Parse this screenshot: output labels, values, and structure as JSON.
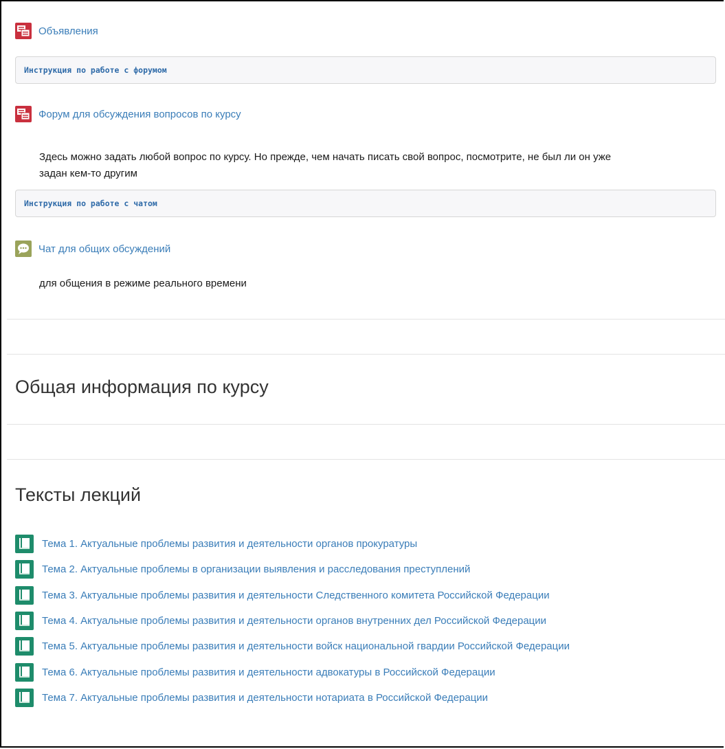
{
  "activities": {
    "announcements": "Объявления",
    "forum_instruction": "Инструкция по работе с форумом",
    "forum": "Форум для обсуждения вопросов по курсу",
    "forum_desc_line1": "Здесь можно задать любой вопрос по курсу. Но прежде, чем начать писать свой вопрос, посмотрите, не был ли он уже",
    "forum_desc_line2": "задан кем-то другим",
    "chat_instruction": "Инструкция по работе с чатом",
    "chat": "Чат для общих обсуждений",
    "chat_desc": "для общения в режиме реального времени"
  },
  "sections": {
    "general_info": "Общая информация по курсу",
    "lectures": "Тексты лекций"
  },
  "topics": [
    "Тема 1. Актуальные проблемы развития и деятельности органов прокуратуры",
    "Тема 2. Актуальные проблемы в организации выявления и расследования преступлений",
    "Тема 3. Актуальные проблемы развития и деятельности Следственного комитета Российской Федерации",
    "Тема 4. Актуальные проблемы развития и деятельности органов внутренних дел Российской Федерации",
    "Тема 5. Актуальные проблемы развития и деятельности войск национальной гвардии Российской Федерации",
    "Тема 6. Актуальные проблемы развития и деятельности адвокатуры в Российской Федерации",
    "Тема 7. Актуальные проблемы развития и деятельности нотариата в Российской Федерации"
  ],
  "icons": {
    "forum": "forum-icon",
    "chat": "chat-icon",
    "book": "book-icon"
  },
  "colors": {
    "link": "#3a7db8",
    "forum_icon": "#c9303e",
    "chat_icon": "#9aa35a",
    "book_icon": "#1e8c6b"
  }
}
